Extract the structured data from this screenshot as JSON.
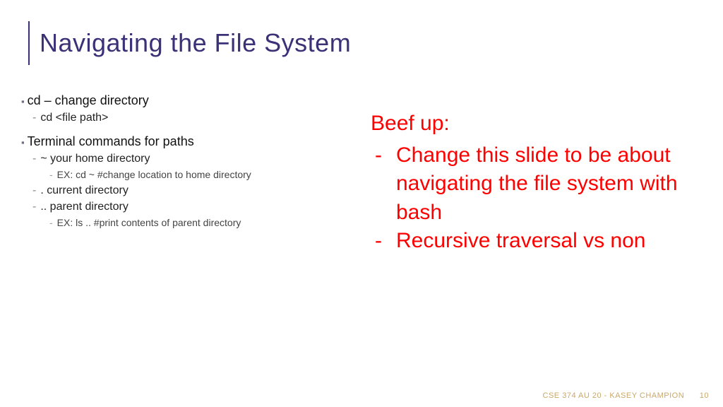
{
  "title": "Navigating the File System",
  "left": {
    "item1": "cd – change directory",
    "item1_sub1": "cd <file path>",
    "item2": "Terminal commands for paths",
    "item2_sub1": "~ your home directory",
    "item2_sub1_ex": "EX: cd ~ #change location to home directory",
    "item2_sub2": ". current directory",
    "item2_sub3": ".. parent directory",
    "item2_sub3_ex": "EX: ls .. #print contents of parent directory"
  },
  "right": {
    "heading": "Beef up:",
    "bullet1": "Change this slide to be about navigating the file system with bash",
    "bullet2": "Recursive traversal vs non"
  },
  "footer": {
    "text": "CSE 374 AU 20 - KASEY CHAMPION",
    "page": "10"
  }
}
